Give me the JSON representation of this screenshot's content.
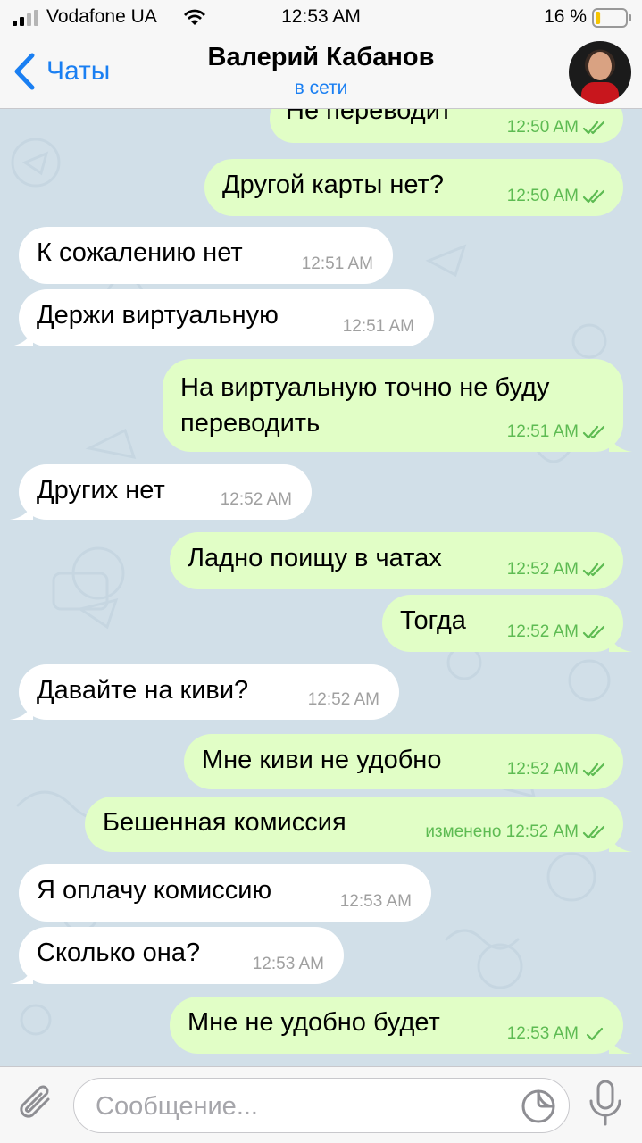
{
  "status_bar": {
    "carrier": "Vodafone UA",
    "time": "12:53 AM",
    "battery": "16 %",
    "battery_level": 0.16,
    "icons": [
      "signal-icon",
      "wifi-icon",
      "battery-icon"
    ]
  },
  "header": {
    "back_label": "Чаты",
    "contact_name": "Валерий Кабанов",
    "contact_status": "в сети"
  },
  "messages": [
    {
      "dir": "out",
      "text": "Не переводит",
      "time": "12:50 AM",
      "checks": "double"
    },
    {
      "dir": "out",
      "text": "Другой карты нет?",
      "time": "12:50 AM",
      "checks": "double"
    },
    {
      "dir": "in",
      "text": "К сожалению нет",
      "time": "12:51 AM"
    },
    {
      "dir": "in",
      "text": "Держи виртуальную",
      "time": "12:51 AM"
    },
    {
      "dir": "out",
      "text": "На виртуальную точно не буду переводить",
      "time": "12:51 AM",
      "checks": "double"
    },
    {
      "dir": "in",
      "text": "Других нет",
      "time": "12:52 AM"
    },
    {
      "dir": "out",
      "text": "Ладно поищу в чатах",
      "time": "12:52 AM",
      "checks": "double"
    },
    {
      "dir": "out",
      "text": "Тогда",
      "time": "12:52 AM",
      "checks": "double"
    },
    {
      "dir": "in",
      "text": "Давайте на киви?",
      "time": "12:52 AM"
    },
    {
      "dir": "out",
      "text": "Мне киви не удобно",
      "time": "12:52 AM",
      "checks": "double"
    },
    {
      "dir": "out",
      "text": "Бешенная комиссия",
      "time": "изменено 12:52 AM",
      "checks": "double"
    },
    {
      "dir": "in",
      "text": "Я оплачу комиссию",
      "time": "12:53 AM"
    },
    {
      "dir": "in",
      "text": "Сколько она?",
      "time": "12:53 AM"
    },
    {
      "dir": "out",
      "text": "Мне не удобно будет",
      "time": "12:53 AM",
      "checks": "single"
    }
  ],
  "input": {
    "placeholder": "Сообщение...",
    "value": ""
  },
  "colors": {
    "accent": "#1a7ff2",
    "outgoing_bubble": "#e1fec6",
    "incoming_bubble": "#ffffff",
    "chat_background": "#d1dfe8",
    "outgoing_meta": "#5dbb52"
  }
}
